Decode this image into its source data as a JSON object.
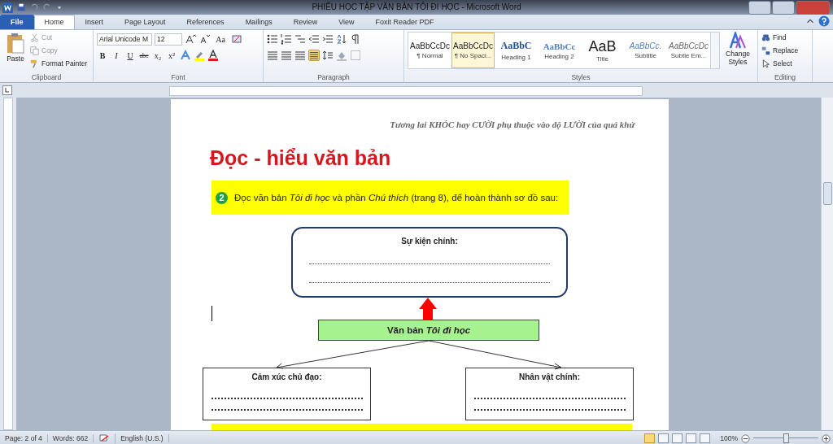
{
  "window": {
    "title": "PHIẾU HỌC TẬP VĂN BẢN TÔI ĐI HỌC  -  Microsoft Word"
  },
  "tabs": [
    {
      "label": "File",
      "kind": "file",
      "selected": false
    },
    {
      "label": "Home",
      "kind": "tab",
      "selected": true
    },
    {
      "label": "Insert",
      "kind": "tab",
      "selected": false
    },
    {
      "label": "Page Layout",
      "kind": "tab",
      "selected": false
    },
    {
      "label": "References",
      "kind": "tab",
      "selected": false
    },
    {
      "label": "Mailings",
      "kind": "tab",
      "selected": false
    },
    {
      "label": "Review",
      "kind": "tab",
      "selected": false
    },
    {
      "label": "View",
      "kind": "tab",
      "selected": false
    },
    {
      "label": "Foxit Reader PDF",
      "kind": "tab",
      "selected": false
    }
  ],
  "clipboard": {
    "label": "Clipboard",
    "paste": "Paste",
    "items": [
      {
        "label": "Cut",
        "disabled": true
      },
      {
        "label": "Copy",
        "disabled": true
      },
      {
        "label": "Format Painter",
        "disabled": false
      }
    ]
  },
  "font": {
    "label": "Font",
    "name": "Arial Unicode M",
    "size": "12",
    "case_button": "Aa",
    "format_buttons": [
      {
        "label": "B",
        "kind": "bold"
      },
      {
        "label": "I",
        "kind": "italic"
      },
      {
        "label": "U",
        "kind": "underline"
      },
      {
        "label": "abc",
        "kind": "strike"
      },
      {
        "label": "x₂",
        "kind": "plain"
      },
      {
        "label": "x²",
        "kind": "plain"
      }
    ]
  },
  "paragraph": {
    "label": "Paragraph",
    "alignment": [
      {
        "selected": false
      },
      {
        "selected": false
      },
      {
        "selected": false
      },
      {
        "selected": true
      }
    ]
  },
  "styles": {
    "label": "Styles",
    "items": [
      {
        "preview": "AaBbCcDc",
        "label": "¶ Normal",
        "kind": "normal",
        "selected": false
      },
      {
        "preview": "AaBbCcDc",
        "label": "¶ No Spaci...",
        "kind": "normal",
        "selected": true
      },
      {
        "preview": "AaBbC",
        "label": "Heading 1",
        "kind": "heading1",
        "selected": false
      },
      {
        "preview": "AaBbCc",
        "label": "Heading 2",
        "kind": "heading2",
        "selected": false
      },
      {
        "preview": "AaB",
        "label": "Title",
        "kind": "title",
        "selected": false
      },
      {
        "preview": "AaBbCc.",
        "label": "Subtitle",
        "kind": "subtitle",
        "selected": false
      },
      {
        "preview": "AaBbCcDc",
        "label": "Subtle Em...",
        "kind": "emphasis",
        "selected": false
      }
    ],
    "change": "Change Styles"
  },
  "editing": {
    "label": "Editing",
    "items": [
      "Find",
      "Replace",
      "Select"
    ]
  },
  "document": {
    "header_quote": "Tương lai KHÓC hay CƯỜI phụ thuộc vào độ LƯỜI của quá khứ",
    "heading": "Đọc - hiểu văn bản",
    "step_number": "2",
    "instruction": "Đọc văn bản *Tôi đi học* và phần *Chú thích* (trang 8), để hoàn thành sơ đồ sau:",
    "diagram": {
      "top": "Sự kiện chính:",
      "center": "Văn bản *Tôi đi học*",
      "left": "Cảm xúc chủ đạo:",
      "right": "Nhân vật chính:"
    }
  },
  "status_bar": {
    "page": "Page: 2 of 4",
    "words": "Words: 662",
    "language": "English (U.S.)",
    "zoom": "100%",
    "zoom_level": {
      "level": 0.5
    }
  }
}
